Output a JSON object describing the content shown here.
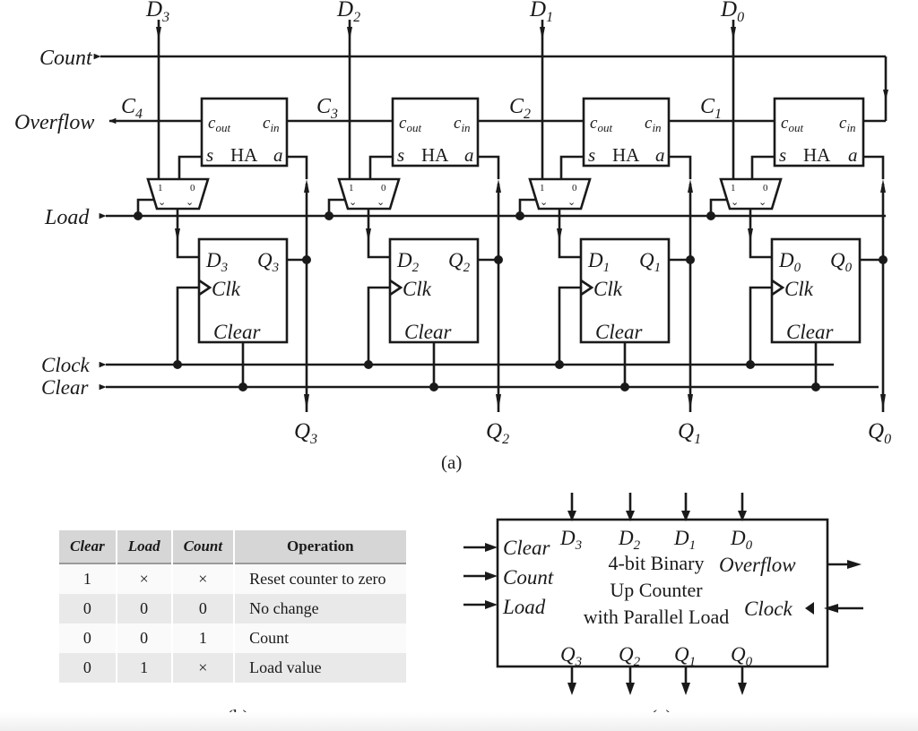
{
  "figure": {
    "captions": {
      "a": "(a)",
      "b": "(b)",
      "c": "(c)"
    }
  },
  "circuit": {
    "data_inputs": [
      "D3",
      "D2",
      "D1",
      "D0"
    ],
    "data_input_labels": [
      {
        "base": "D",
        "sub": "3"
      },
      {
        "base": "D",
        "sub": "2"
      },
      {
        "base": "D",
        "sub": "1"
      },
      {
        "base": "D",
        "sub": "0"
      }
    ],
    "q_output_labels": [
      {
        "base": "Q",
        "sub": "3"
      },
      {
        "base": "Q",
        "sub": "2"
      },
      {
        "base": "Q",
        "sub": "1"
      },
      {
        "base": "Q",
        "sub": "0"
      }
    ],
    "carry_labels": [
      {
        "base": "C",
        "sub": "4"
      },
      {
        "base": "C",
        "sub": "3"
      },
      {
        "base": "C",
        "sub": "2"
      },
      {
        "base": "C",
        "sub": "1"
      }
    ],
    "left_ports": [
      "Count",
      "Overflow",
      "Load",
      "Clock",
      "Clear"
    ],
    "ha": {
      "name": "HA",
      "cout": "c",
      "cout_sub": "out",
      "cin": "c",
      "cin_sub": "in",
      "s": "s",
      "a": "a"
    },
    "mux": {
      "one": "1",
      "zero": "0"
    },
    "ff": {
      "clk": "Clk",
      "clear": "Clear",
      "d_labels": [
        {
          "base": "D",
          "sub": "3"
        },
        {
          "base": "D",
          "sub": "2"
        },
        {
          "base": "D",
          "sub": "1"
        },
        {
          "base": "D",
          "sub": "0"
        }
      ],
      "q_labels": [
        {
          "base": "Q",
          "sub": "3"
        },
        {
          "base": "Q",
          "sub": "2"
        },
        {
          "base": "Q",
          "sub": "1"
        },
        {
          "base": "Q",
          "sub": "0"
        }
      ]
    }
  },
  "table": {
    "headers": [
      "Clear",
      "Load",
      "Count",
      "Operation"
    ],
    "rows": [
      {
        "clear": "1",
        "load": "×",
        "count": "×",
        "operation": "Reset counter to zero"
      },
      {
        "clear": "0",
        "load": "0",
        "count": "0",
        "operation": "No change"
      },
      {
        "clear": "0",
        "load": "0",
        "count": "1",
        "operation": "Count"
      },
      {
        "clear": "0",
        "load": "1",
        "count": "×",
        "operation": "Load value"
      }
    ]
  },
  "block": {
    "title_lines": [
      "4-bit Binary",
      "Up Counter",
      "with Parallel Load"
    ],
    "inputs_left": [
      "Clear",
      "Count",
      "Load"
    ],
    "outputs_right": [
      "Overflow"
    ],
    "inputs_right": [
      "Clock"
    ],
    "top_ports": [
      {
        "base": "D",
        "sub": "3"
      },
      {
        "base": "D",
        "sub": "2"
      },
      {
        "base": "D",
        "sub": "1"
      },
      {
        "base": "D",
        "sub": "0"
      }
    ],
    "bottom_ports": [
      {
        "base": "Q",
        "sub": "3"
      },
      {
        "base": "Q",
        "sub": "2"
      },
      {
        "base": "Q",
        "sub": "1"
      },
      {
        "base": "Q",
        "sub": "0"
      }
    ]
  },
  "colors": {
    "ink": "#1a1a1a",
    "wire": "#1a1a1a",
    "table_header_bg": "#d6d6d6",
    "table_row_odd": "#fafafa",
    "table_row_even": "#e9e9e9",
    "page_bg": "#ffffff"
  }
}
